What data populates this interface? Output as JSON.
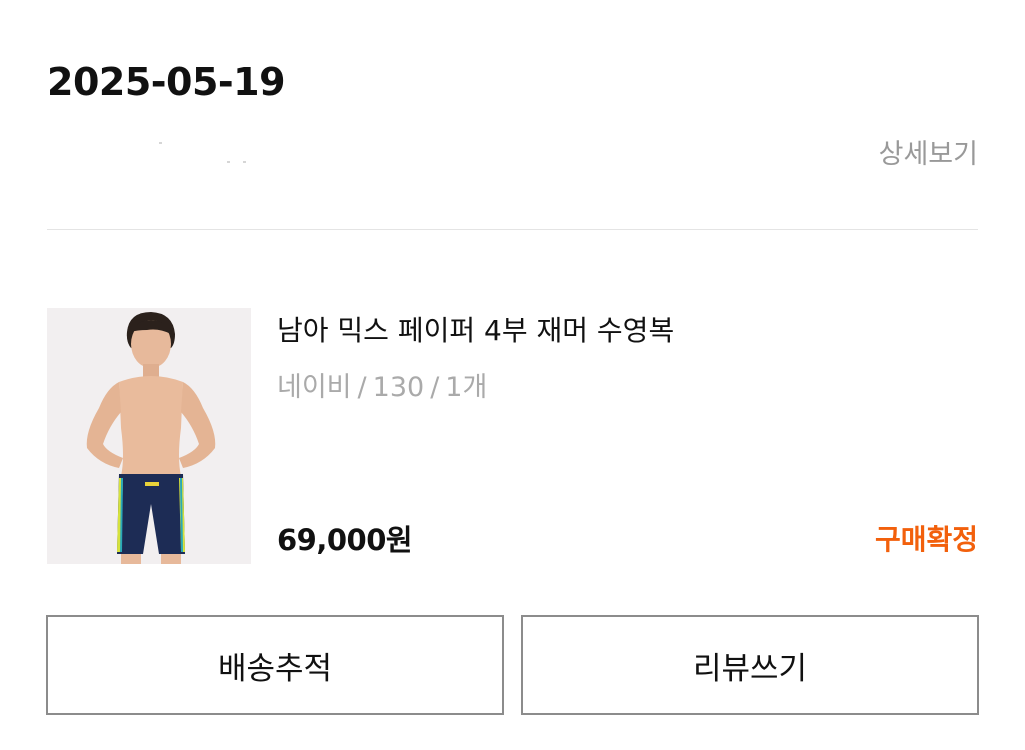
{
  "order": {
    "date": "2025-05-19",
    "detail_link_label": "상세보기"
  },
  "product": {
    "image_icon": "swimsuit-product-photo",
    "name": "남아 믹스 페이퍼 4부 재머 수영복",
    "option": {
      "color": "네이비",
      "size": "130",
      "quantity": "1개",
      "separator": "/"
    },
    "price": "69,000원",
    "status": "구매확정",
    "status_color": "#f2600c"
  },
  "actions": {
    "track_label": "배송추적",
    "review_label": "리뷰쓰기"
  }
}
